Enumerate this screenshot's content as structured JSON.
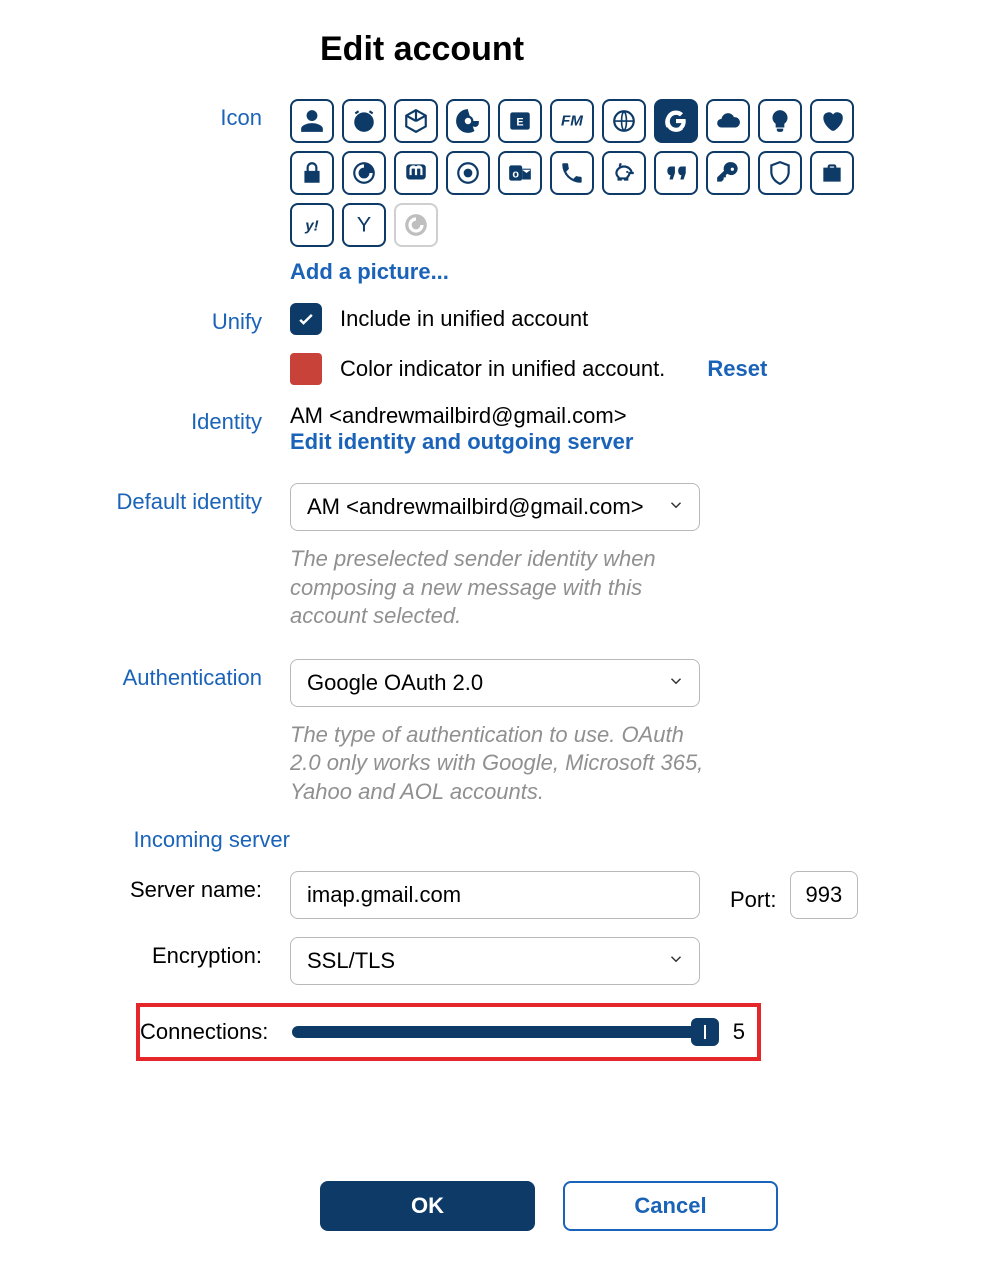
{
  "title": "Edit account",
  "labels": {
    "icon": "Icon",
    "unify": "Unify",
    "identity": "Identity",
    "default_identity": "Default identity",
    "authentication": "Authentication",
    "incoming_server": "Incoming server",
    "server_name": "Server name:",
    "encryption": "Encryption:",
    "port": "Port:",
    "connections": "Connections:"
  },
  "icon_picker": {
    "icons": [
      "person-icon",
      "clock-icon",
      "cube-icon",
      "at-icon",
      "exchange-icon",
      "fastmail-icon",
      "globe-icon",
      "google-icon",
      "cloud-icon",
      "bulb-icon",
      "heart-icon",
      "lock-icon",
      "spiral-icon",
      "mastodon-icon",
      "eye-icon",
      "outlook-icon",
      "phone-icon",
      "piggy-icon",
      "quote-icon",
      "key-icon",
      "shield-icon",
      "briefcase-icon",
      "yahoo-icon",
      "gamma-icon",
      "circle-icon"
    ],
    "selected": "google-icon",
    "add_picture": "Add a picture..."
  },
  "unify": {
    "include_label": "Include in unified account",
    "include_checked": true,
    "color_label": "Color indicator in unified account.",
    "color": "#c8423a",
    "reset": "Reset"
  },
  "identity": {
    "text": "AM <andrewmailbird@gmail.com>",
    "edit_link": "Edit identity and outgoing server"
  },
  "default_identity": {
    "value": "AM <andrewmailbird@gmail.com>",
    "helper": "The preselected sender identity when composing a new message with this account selected."
  },
  "authentication": {
    "value": "Google OAuth 2.0",
    "helper": "The type of authentication to use. OAuth 2.0 only works with Google, Microsoft 365, Yahoo and AOL accounts."
  },
  "incoming": {
    "server_name": "imap.gmail.com",
    "encryption": "SSL/TLS",
    "port": "993",
    "connections": "5"
  },
  "buttons": {
    "ok": "OK",
    "cancel": "Cancel"
  }
}
